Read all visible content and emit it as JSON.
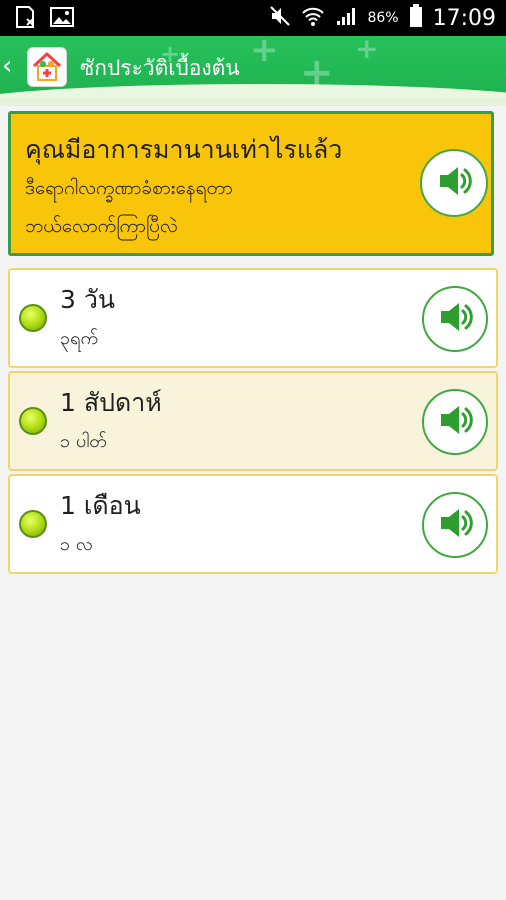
{
  "status_bar": {
    "battery_percent": "86%",
    "time": "17:09",
    "icons": [
      "sd-card-icon",
      "image-icon",
      "mute-icon",
      "wifi-icon",
      "signal-icon",
      "battery-icon"
    ]
  },
  "app_bar": {
    "title": "ซักประวัติเบื้องต้น",
    "icons": [
      "back-chevron-icon",
      "app-logo-icon"
    ]
  },
  "question": {
    "thai": "คุณมีอาการมานานเท่าไรแล้ว",
    "burmese_line1": "ဒီရောဂါလက္ခဏာခံစားနေရတာ",
    "burmese_line2": "ဘယ်လောက်ကြာပြီလဲ",
    "audio_icon": "speaker-icon"
  },
  "options": [
    {
      "thai": "3  วัน",
      "burmese": "၃ရက်",
      "selected": false
    },
    {
      "thai": "1  สัปดาห์",
      "burmese": "၁ ပါတ်",
      "selected": true
    },
    {
      "thai": "1  เดือน",
      "burmese": "၁ လ",
      "selected": false
    }
  ],
  "colors": {
    "app_bar": "#27c15b",
    "question_card": "#f9c50b",
    "question_border": "#3a9c44",
    "option_border": "#f0d66a",
    "speaker_green": "#2e9e2f"
  }
}
